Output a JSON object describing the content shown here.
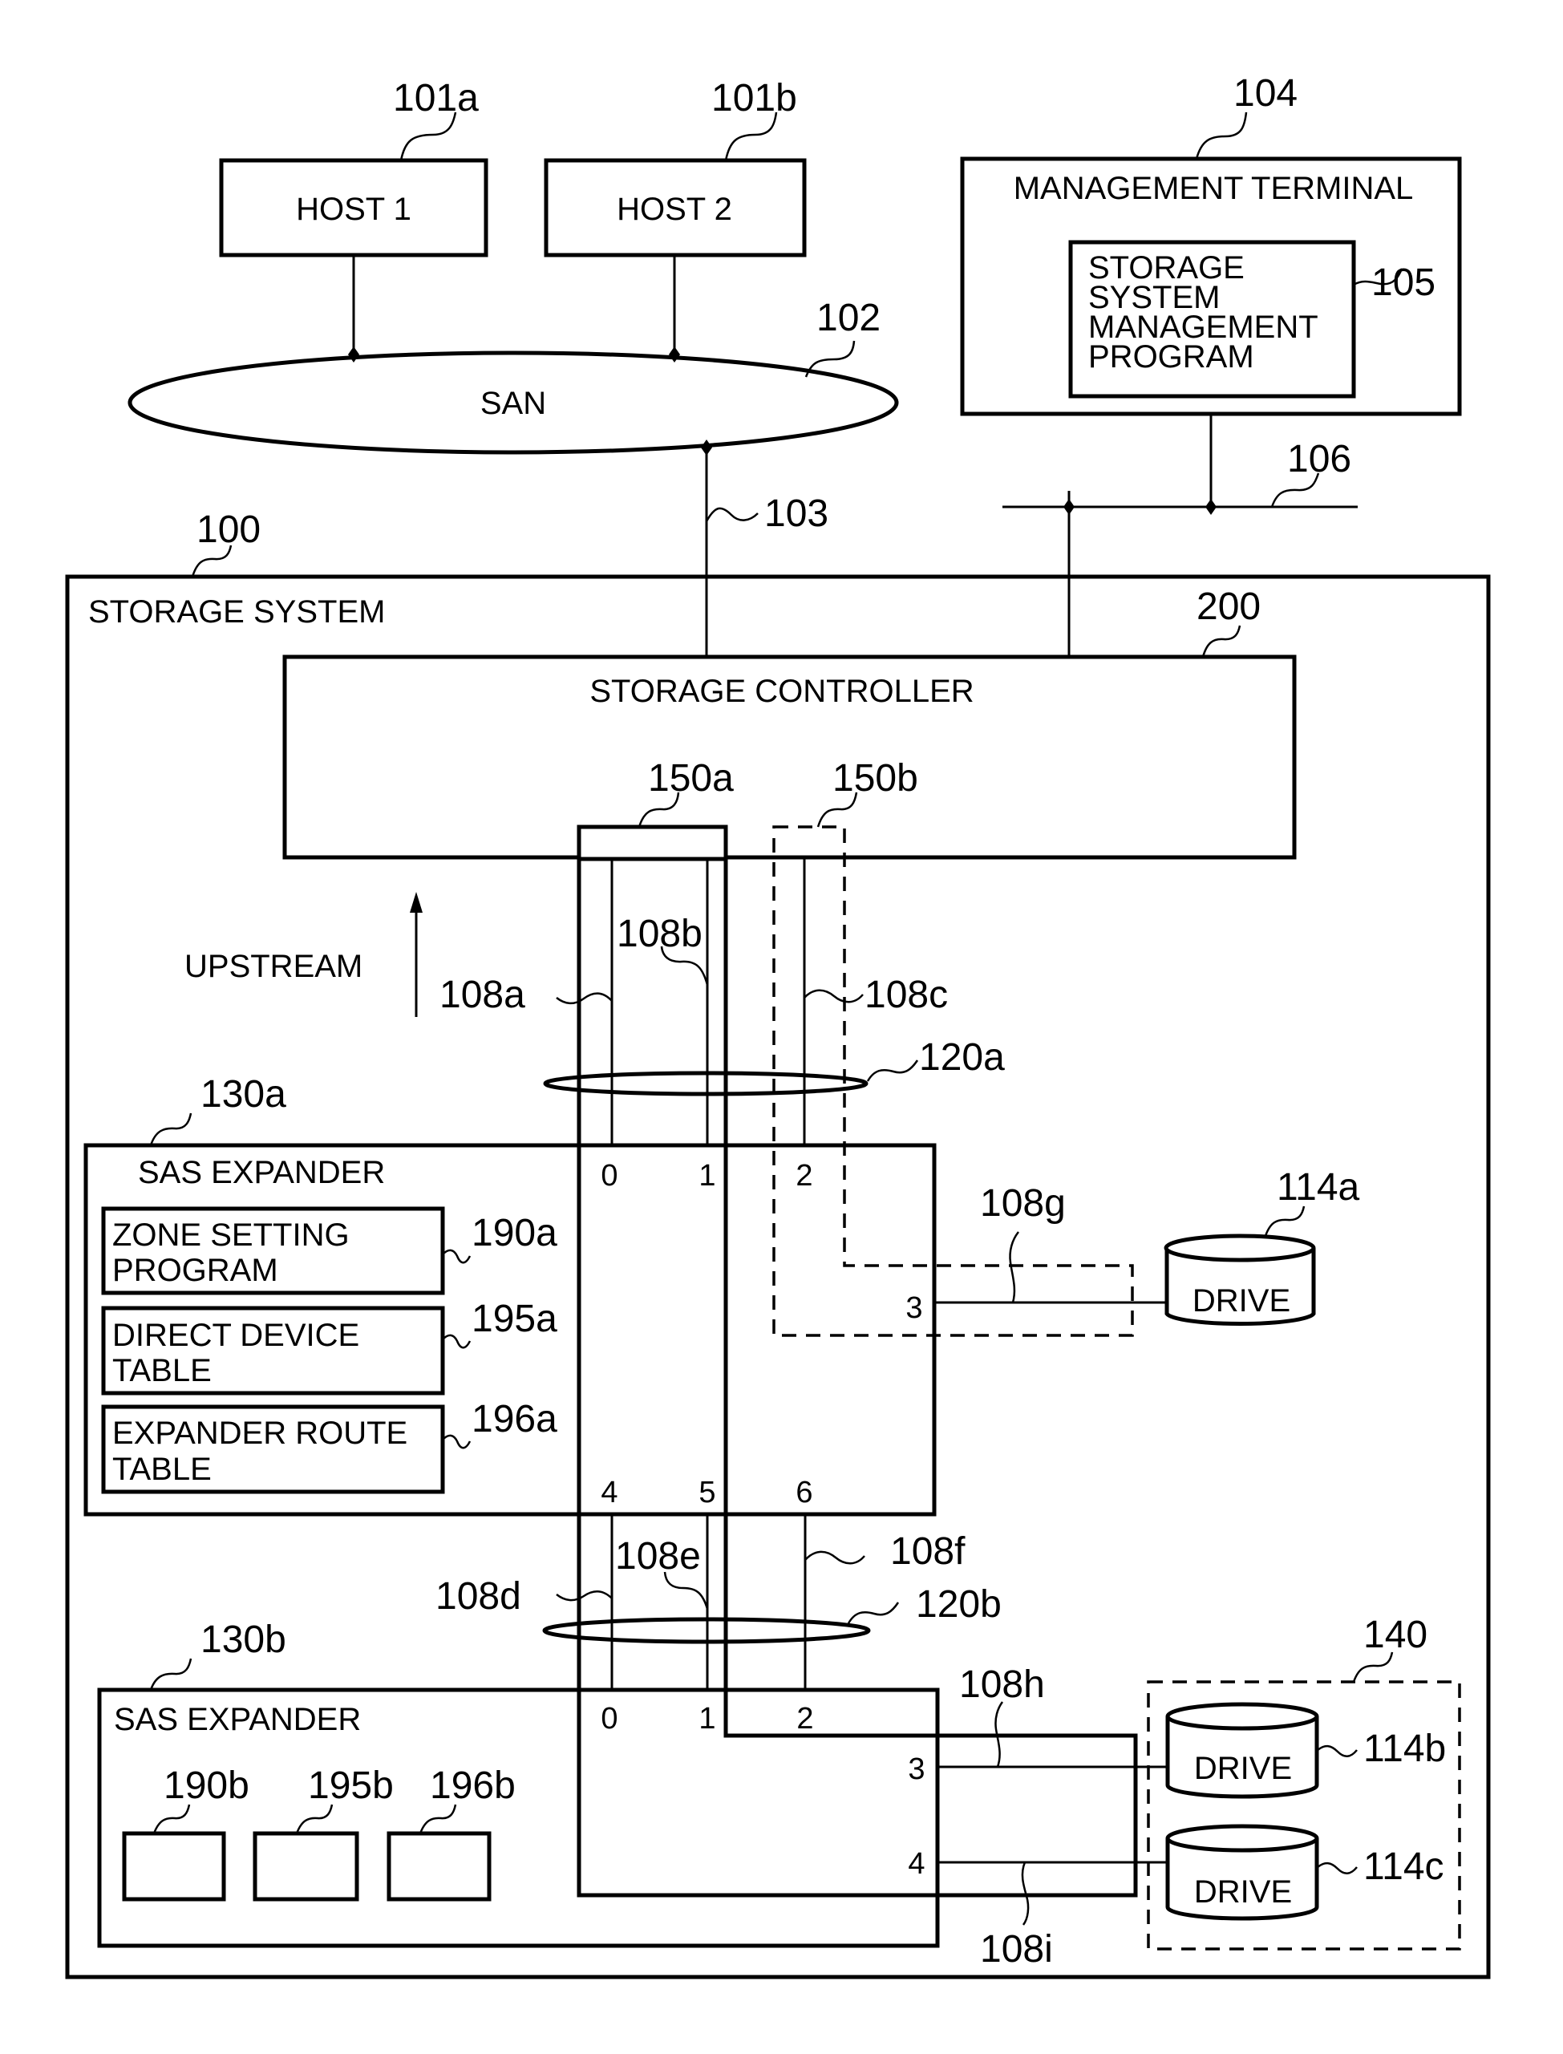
{
  "figure": {
    "hosts": [
      {
        "ref": "101a",
        "label": "HOST 1"
      },
      {
        "ref": "101b",
        "label": "HOST 2"
      }
    ],
    "san": {
      "ref": "102",
      "label": "SAN"
    },
    "san_link_ref": "103",
    "management_terminal": {
      "ref": "104",
      "label": "MANAGEMENT TERMINAL",
      "program": {
        "ref": "105",
        "lines": [
          "STORAGE",
          "SYSTEM",
          "MANAGEMENT",
          "PROGRAM"
        ]
      }
    },
    "management_network_ref": "106",
    "storage_system": {
      "ref": "100",
      "label": "STORAGE SYSTEM"
    },
    "storage_controller": {
      "ref": "200",
      "label": "STORAGE  CONTROLLER"
    },
    "initiator_ports": [
      {
        "ref": "150a",
        "style": "solid"
      },
      {
        "ref": "150b",
        "style": "dashed"
      }
    ],
    "direction": {
      "label": "UPSTREAM",
      "icon": "up-arrow-icon"
    },
    "links_upper": [
      {
        "ref": "108a"
      },
      {
        "ref": "108b"
      },
      {
        "ref": "108c"
      }
    ],
    "wide_port_upper": {
      "ref": "120a"
    },
    "expander_a": {
      "ref": "130a",
      "label": "SAS EXPANDER",
      "ports_top": [
        "0",
        "1",
        "2"
      ],
      "port_right": "3",
      "ports_bottom": [
        "4",
        "5",
        "6"
      ],
      "modules": [
        {
          "ref": "190a",
          "lines": [
            "ZONE SETTING",
            "PROGRAM"
          ]
        },
        {
          "ref": "195a",
          "lines": [
            "DIRECT DEVICE",
            "TABLE"
          ]
        },
        {
          "ref": "196a",
          "lines": [
            "EXPANDER ROUTE",
            "TABLE"
          ]
        }
      ]
    },
    "link_g": {
      "ref": "108g"
    },
    "drive_a": {
      "ref": "114a",
      "label": "DRIVE"
    },
    "links_lower": [
      {
        "ref": "108d"
      },
      {
        "ref": "108e"
      },
      {
        "ref": "108f"
      }
    ],
    "wide_port_lower": {
      "ref": "120b"
    },
    "expander_b": {
      "ref": "130b",
      "label": "SAS EXPANDER",
      "ports_top": [
        "0",
        "1",
        "2"
      ],
      "ports_right": [
        "3",
        "4"
      ],
      "modules": [
        {
          "ref": "190b"
        },
        {
          "ref": "195b"
        },
        {
          "ref": "196b"
        }
      ]
    },
    "link_h": {
      "ref": "108h"
    },
    "link_i": {
      "ref": "108i"
    },
    "enclosure": {
      "ref": "140",
      "drives": [
        {
          "ref": "114b",
          "label": "DRIVE"
        },
        {
          "ref": "114c",
          "label": "DRIVE"
        }
      ]
    }
  }
}
